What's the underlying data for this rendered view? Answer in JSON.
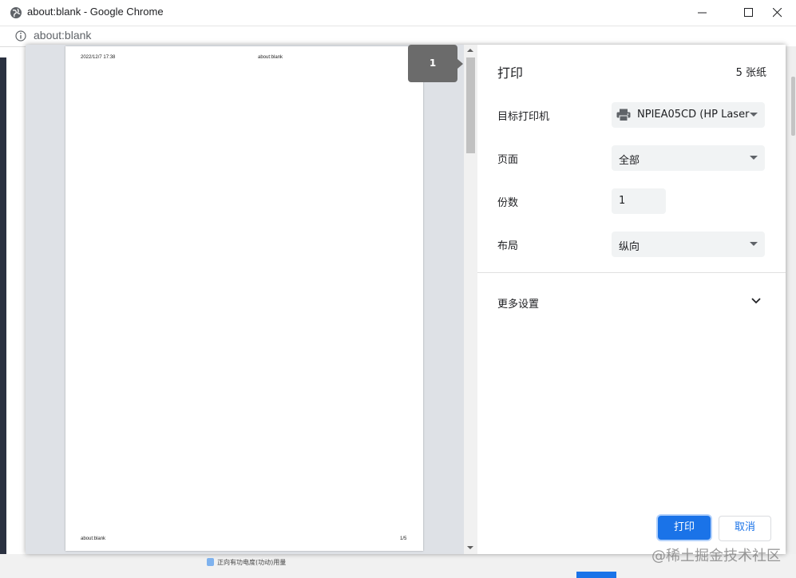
{
  "window": {
    "title": "about:blank - Google Chrome",
    "address": "about:blank"
  },
  "preview": {
    "header_datetime": "2022/12/7 17:38",
    "header_title": "about:blank",
    "footer_url": "about:blank",
    "footer_page": "1/5",
    "page_badge": "1"
  },
  "settings": {
    "title": "打印",
    "sheets": "5 张纸",
    "destination_label": "目标打印机",
    "destination_value": "NPIEA05CD (HP Laser",
    "destination_icon": "printer-icon",
    "pages_label": "页面",
    "pages_value": "全部",
    "copies_label": "份数",
    "copies_value": "1",
    "layout_label": "布局",
    "layout_value": "纵向",
    "more_settings": "更多设置",
    "print_button": "打印",
    "cancel_button": "取消"
  },
  "status": {
    "text": "正向有功电度(功动)用量"
  },
  "watermark": "@稀土掘金技术社区",
  "colors": {
    "accent": "#1a73e8",
    "preview_bg": "#dee1e6",
    "control_bg": "#f1f3f4",
    "page_badge": "#6b6b6b"
  }
}
